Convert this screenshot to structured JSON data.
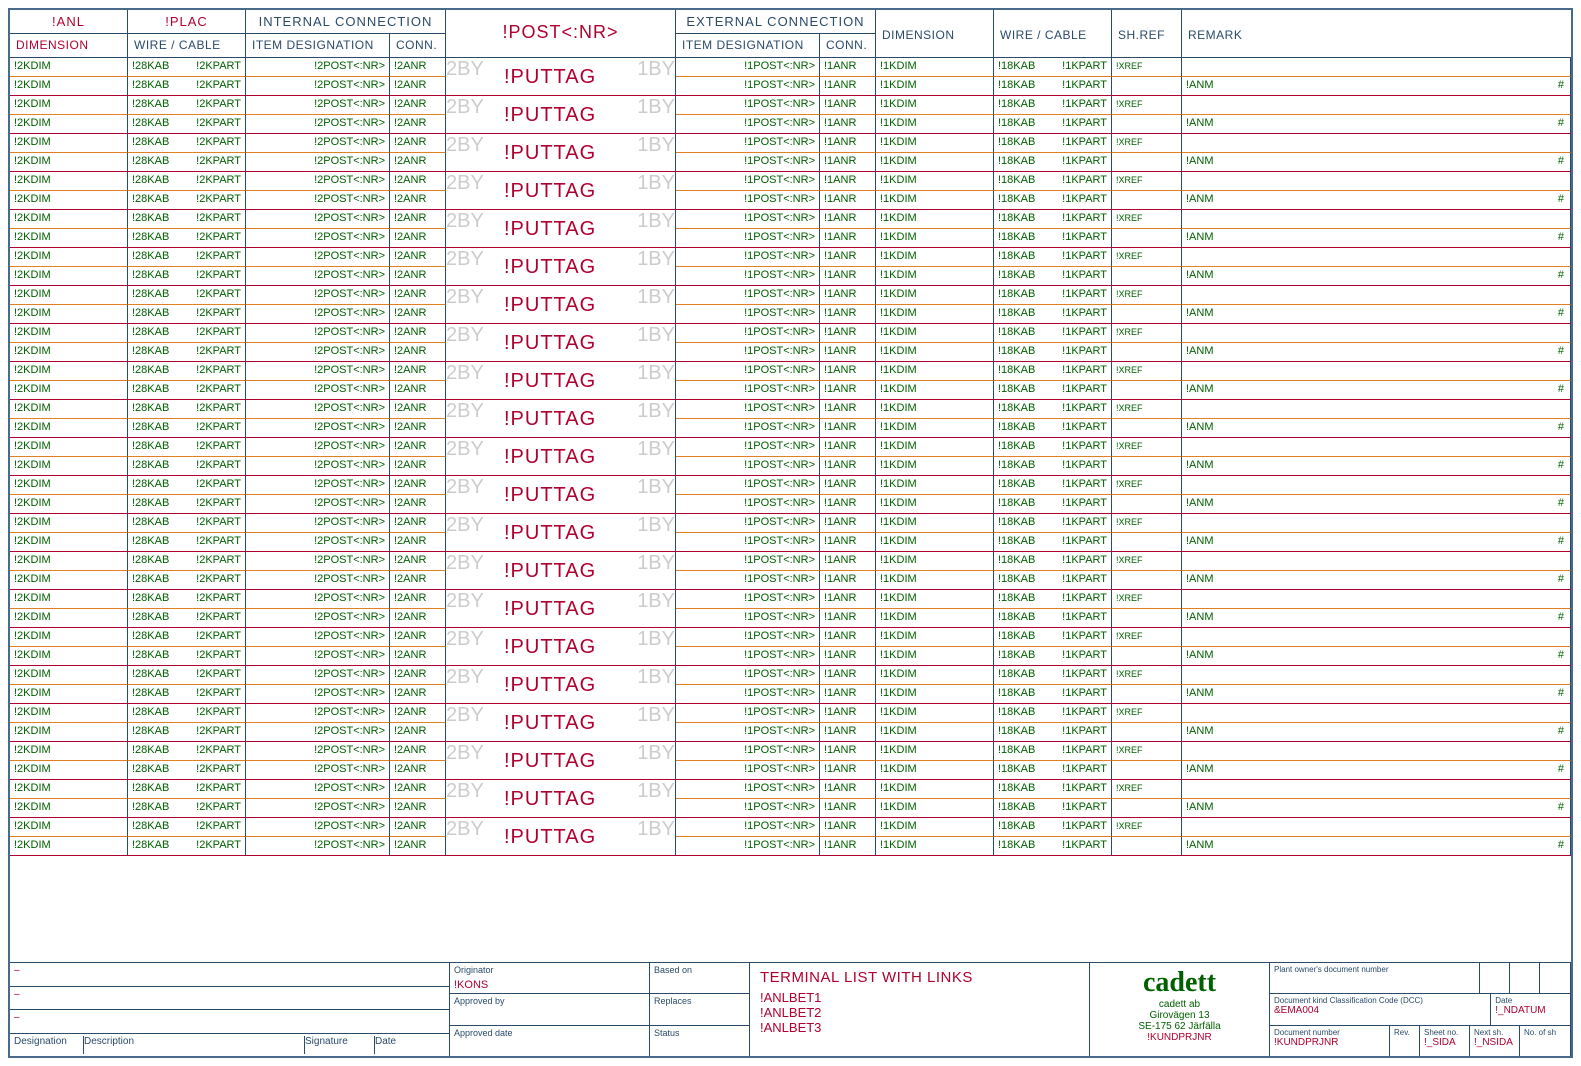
{
  "header": {
    "anl": "!ANL",
    "plac": "!PLAC",
    "internal_conn": "INTERNAL CONNECTION",
    "external_conn": "EXTERNAL CONNECTION",
    "dimension": "DIMENSION",
    "wire_cable": "WIRE / CABLE",
    "item_desig": "ITEM DESIGNATION",
    "conn": "CONN.",
    "centre": "!POST<:NR>",
    "shref": "SH.REF",
    "remark": "REMARK"
  },
  "row": {
    "c2kdim": "!2KDIM",
    "c28kab": "!28KAB",
    "c2kpart": "!2KPART",
    "c2post": "!2POST<:NR>",
    "c2anr": "!2ANR",
    "c2by": "2BY",
    "puttag": "!PUTTAG",
    "c1by": "1BY",
    "c1post": "!1POST<:NR>",
    "c1anr": "!1ANR",
    "c1kdim": "!1KDIM",
    "c18kab": "!18KAB",
    "c1kpart": "!1KPART",
    "xref": "!XREF",
    "anm": "!ANM",
    "sharp": "#"
  },
  "row_count": 21,
  "titleblock": {
    "designation": "Designation",
    "description": "Description",
    "signature": "Signature",
    "date": "Date",
    "originator": "Originator",
    "kons": "!KONS",
    "approved_by": "Approved by",
    "replaces": "Replaces",
    "approved_date": "Approved date",
    "status": "Status",
    "based_on": "Based on",
    "main_title": "TERMINAL LIST WITH LINKS",
    "anlbet1": "!ANLBET1",
    "anlbet2": "!ANLBET2",
    "anlbet3": "!ANLBET3",
    "logo": "cadett",
    "company": "cadett ab",
    "addr1": "Girovägen 13",
    "addr2": "SE-175 62 Järfälla",
    "kundprjnr": "!KUNDPRJNR",
    "plant_owner": "Plant owner's document number",
    "dcc": "Document kind Classification Code (DCC)",
    "ema": "&EMA004",
    "docnum": "Document number",
    "kundprjnr2": "!KUNDPRJNR",
    "rev": "Rev.",
    "date_lbl": "Date",
    "ndatum": "!_NDATUM",
    "sheetno": "Sheet no.",
    "sida": "!_SIDA",
    "nextsh": "Next sh.",
    "nsida": "!_NSIDA",
    "noofsh": "No. of sh"
  },
  "colors": {
    "border": "#2a4a6a",
    "red": "#b00030",
    "green": "#006000",
    "orange": "#e08020"
  }
}
